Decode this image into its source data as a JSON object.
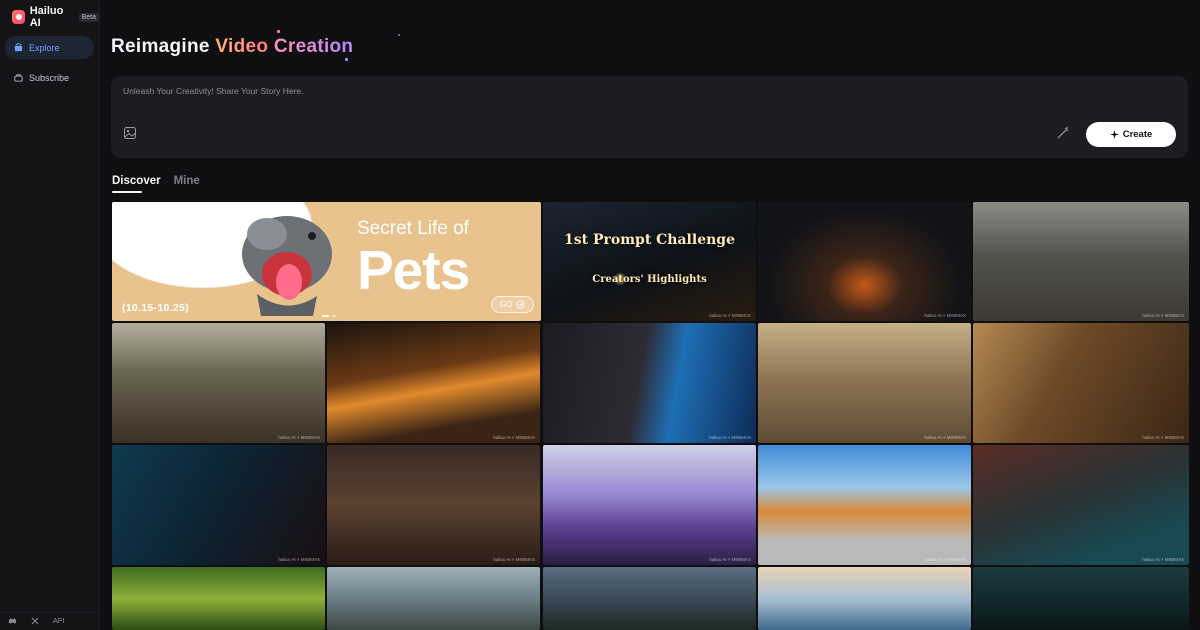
{
  "brand": {
    "name": "Hailuo AI",
    "badge": "Beta"
  },
  "sidebar": {
    "items": [
      {
        "label": "Explore",
        "icon": "explore-icon",
        "active": true
      },
      {
        "label": "Subscribe",
        "icon": "subscribe-icon",
        "active": false
      }
    ],
    "footer": {
      "discord_icon": "discord-icon",
      "x_icon": "x-icon",
      "api_label": "API"
    }
  },
  "hero": {
    "word1": "Reimagine",
    "word2": "Video",
    "word3": "Creation"
  },
  "prompt": {
    "placeholder": "Unleash Your Creativity! Share Your Story Here.",
    "value": "",
    "image_icon": "image-icon",
    "wand_icon": "magic-wand-icon",
    "create_label": "Create"
  },
  "tabs": [
    {
      "label": "Discover",
      "active": true
    },
    {
      "label": "Mine",
      "active": false
    }
  ],
  "banner": {
    "title_line1": "Secret Life of",
    "title_line2": "Pets",
    "dates": "(10.15-10.25)",
    "go_label": "GO"
  },
  "challenge": {
    "line1": "1st Prompt Challenge",
    "line2": "Creators' Highlights"
  },
  "watermark": "hailuo AI × MINIMAX",
  "colors": {
    "accent": "#6ea1ff",
    "background": "#0f0f12",
    "panel": "#1c1c21",
    "banner": "#e9c38d"
  }
}
